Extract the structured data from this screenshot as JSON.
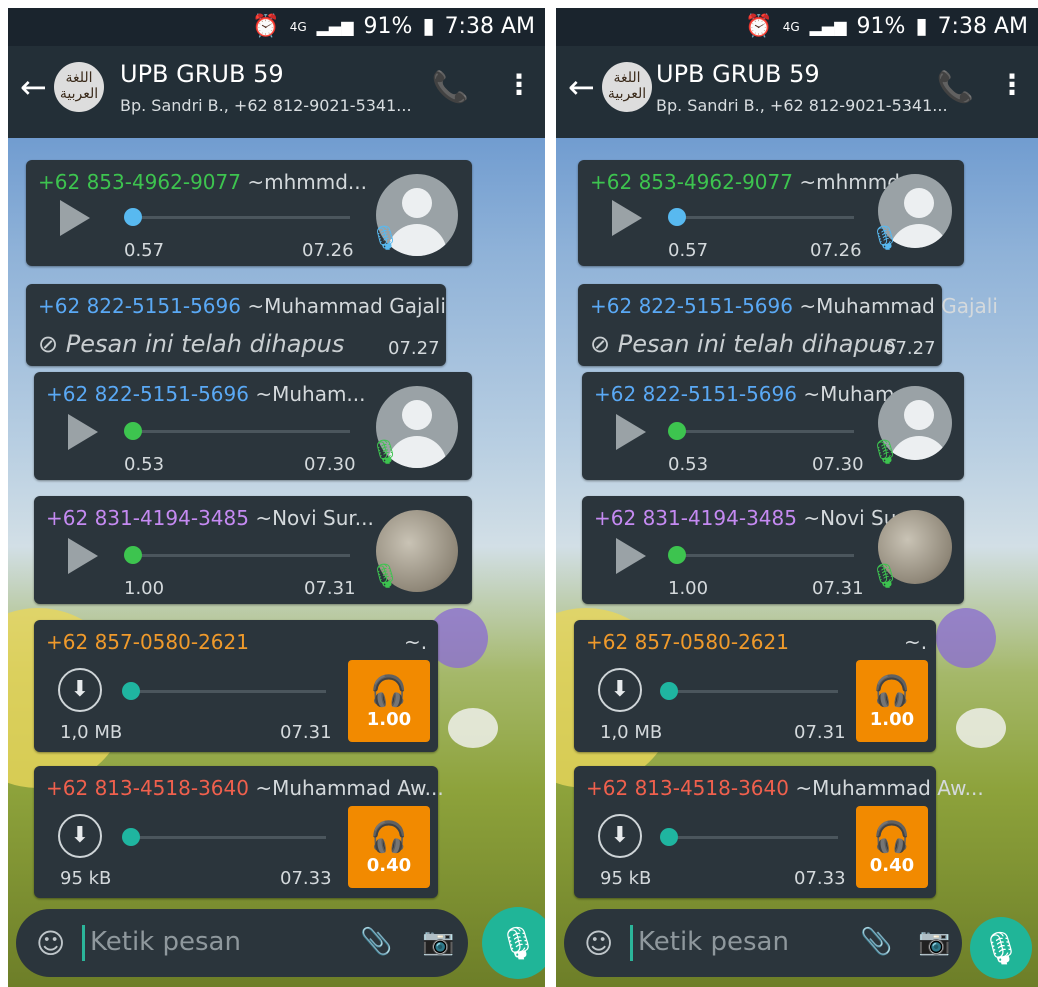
{
  "status": {
    "alarm_icon": "alarm-icon",
    "network": "4G",
    "battery": "91%",
    "time": "7:38 AM"
  },
  "header": {
    "title": "UPB GRUB 59",
    "subtitle": "Bp. Sandri B., +62 812-9021-5341...",
    "avatar_text": "اللغة العربية"
  },
  "messages": [
    {
      "sender": "+62 853-4962-9077",
      "alias": "~mhmmd...",
      "duration": "0.57",
      "time": "07.26",
      "sender_color": "#3dc44f",
      "dot_color": "#58b9f0",
      "mic_color": "#58b9f0"
    },
    {
      "sender": "+62 822-5151-5696",
      "alias": "~Muhammad Gajali",
      "deleted_text": "Pesan ini telah dihapus",
      "time": "07.27",
      "sender_color": "#5aa9f5"
    },
    {
      "sender": "+62 822-5151-5696",
      "alias": "~Muham...",
      "duration": "0.53",
      "time": "07.30",
      "sender_color": "#5aa9f5",
      "dot_color": "#3dc44f",
      "mic_color": "#3dc44f"
    },
    {
      "sender": "+62 831-4194-3485",
      "alias": "~Novi Sur...",
      "duration": "1.00",
      "time": "07.31",
      "sender_color": "#c58af2",
      "dot_color": "#3dc44f",
      "mic_color": "#3dc44f"
    },
    {
      "sender": "+62 857-0580-2621",
      "alias": "~.",
      "size": "1,0 MB",
      "time": "07.31",
      "audio_length": "1.00",
      "sender_color": "#f09a2b",
      "dot_color": "#1fb5a0"
    },
    {
      "sender": "+62 813-4518-3640",
      "alias": "~Muhammad Aw...",
      "size": "95 kB",
      "time": "07.33",
      "audio_length": "0.40",
      "sender_color": "#f0604d",
      "dot_color": "#1fb5a0"
    }
  ],
  "composer": {
    "placeholder": "Ketik pesan"
  }
}
